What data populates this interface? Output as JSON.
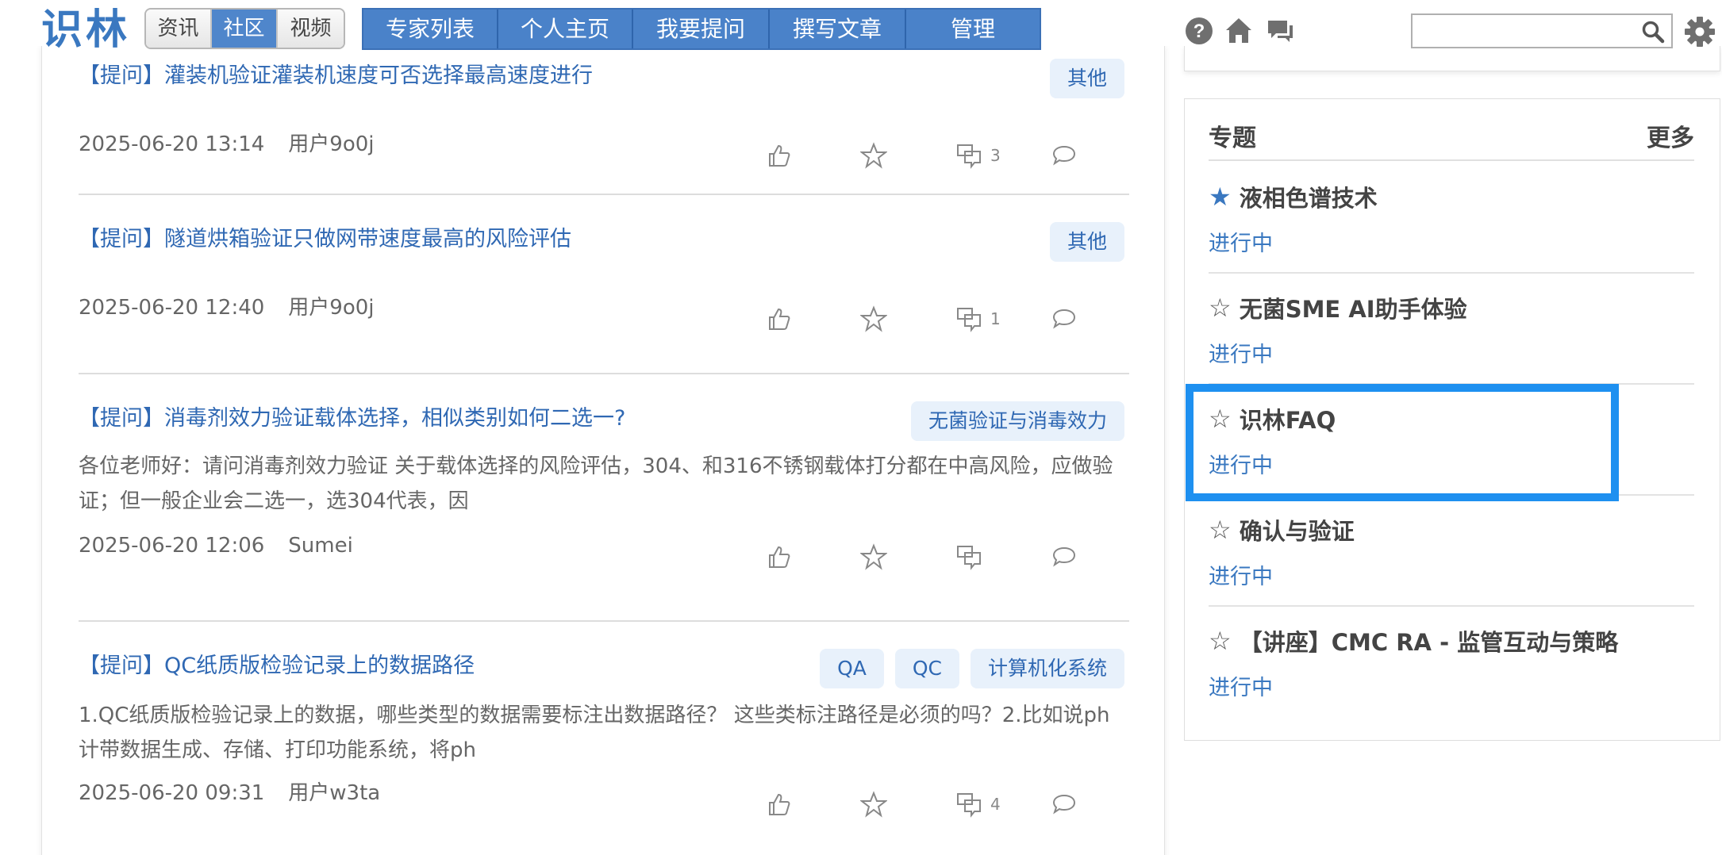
{
  "header": {
    "logo": "识林",
    "segments": [
      {
        "label": "资讯",
        "active": false
      },
      {
        "label": "社区",
        "active": true
      },
      {
        "label": "视频",
        "active": false
      }
    ],
    "nav": [
      {
        "label": "专家列表",
        "width": 170
      },
      {
        "label": "个人主页",
        "width": 170
      },
      {
        "label": "我要提问",
        "width": 172
      },
      {
        "label": "撰写文章",
        "width": 172
      },
      {
        "label": "管理",
        "width": 168
      }
    ],
    "icons": [
      "help-icon",
      "home-icon",
      "chat-icon",
      "search-icon",
      "gear-icon"
    ],
    "search_placeholder": "",
    "accent": "#4a82c9"
  },
  "posts": [
    {
      "prefix": "【提问】",
      "title": "灌装机验证灌装机速度可否选择最高速度进行",
      "tags": [
        "其他"
      ],
      "excerpt": "",
      "date": "2025-06-20 13:14",
      "author": "用户9o0j",
      "replies": "3"
    },
    {
      "prefix": "【提问】",
      "title": "隧道烘箱验证只做网带速度最高的风险评估",
      "tags": [
        "其他"
      ],
      "excerpt": "",
      "date": "2025-06-20 12:40",
      "author": "用户9o0j",
      "replies": "1"
    },
    {
      "prefix": "【提问】",
      "title": "消毒剂效力验证载体选择，相似类别如何二选一?",
      "tags": [
        "无菌验证与消毒效力"
      ],
      "excerpt": "各位老师好：请问消毒剂效力验证 关于载体选择的风险评估，304、和316不锈钢载体打分都在中高风险，应做验证；但一般企业会二选一，选304代表，因",
      "date": "2025-06-20 12:06",
      "author": "Sumei",
      "replies": ""
    },
    {
      "prefix": "【提问】",
      "title": "QC纸质版检验记录上的数据路径",
      "tags": [
        "QA",
        "QC",
        "计算机化系统"
      ],
      "excerpt": "1.QC纸质版检验记录上的数据，哪些类型的数据需要标注出数据路径？ 这些类标注路径是必须的吗？2.比如说ph计带数据生成、存储、打印功能系统，将ph",
      "date": "2025-06-20 09:31",
      "author": "用户w3ta",
      "replies": "4"
    }
  ],
  "sidebar": {
    "title": "专题",
    "more": "更多",
    "topics": [
      {
        "star": "★",
        "filled": true,
        "name": "液相色谱技术",
        "status": "进行中"
      },
      {
        "star": "☆",
        "filled": false,
        "name": "无菌SME AI助手体验",
        "status": "进行中"
      },
      {
        "star": "☆",
        "filled": false,
        "name": "识林FAQ",
        "status": "进行中"
      },
      {
        "star": "☆",
        "filled": false,
        "name": "确认与验证",
        "status": "进行中"
      },
      {
        "star": "☆",
        "filled": false,
        "name": "【讲座】CMC RA - 监管互动与策略",
        "status": "进行中"
      }
    ],
    "status_color": "#3a78c0",
    "highlight_color": "#1e90f0"
  }
}
